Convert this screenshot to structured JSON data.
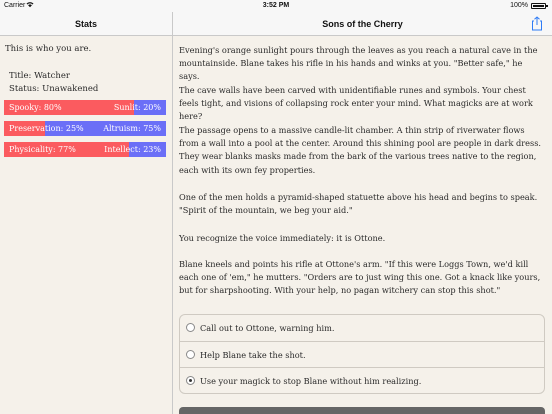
{
  "status_bar": {
    "carrier": "Carrier",
    "time": "3:52 PM",
    "battery": "100%"
  },
  "sidebar": {
    "nav_title": "Stats",
    "intro": "This is who you are.",
    "title_line": "Title: Watcher",
    "status_line": "Status: Unawakened",
    "bars": [
      {
        "left": "Spooky: 80%",
        "right": "Sunlit: 20%",
        "fill": 0.8
      },
      {
        "left": "Preservation: 25%",
        "right": "Altruism: 75%",
        "fill": 0.25
      },
      {
        "left": "Physicality: 77%",
        "right": "Intellect: 23%",
        "fill": 0.77
      }
    ],
    "colors": {
      "left_fill": "#fb5b5f",
      "right_fill": "#6b6ff7"
    }
  },
  "main": {
    "nav_title": "Sons of the Cherry",
    "paragraphs": [
      "Evening's orange sunlight pours through the leaves as you reach a natural cave in the mountainside. Blane takes his rifle in his hands and winks at you. \"Better safe,\" he says.",
      "The cave walls have been carved with unidentifiable runes and symbols. Your chest feels tight, and visions of collapsing rock enter your mind. What magicks are at work here?",
      "The passage opens to a massive candle-lit chamber. A thin strip of riverwater flows from a wall into a pool at the center. Around this shining pool are people in dark dress. They wear blanks masks made from the bark of the various trees native to the region, each with its own fey properties.",
      "One of the men holds a pyramid-shaped statuette above his head and begins to speak. \"Spirit of the mountain, we beg your aid.\"",
      "You recognize the voice immediately: it is Ottone.",
      "Blane kneels and points his rifle at Ottone's arm. \"If this were Loggs Town, we'd kill each one of 'em,\" he mutters. \"Orders are to just wing this one. Got a knack like yours, but for sharpshooting. With your help, no pagan witchery can stop this shot.\""
    ],
    "choices": [
      {
        "label": "Call out to Ottone, warning him.",
        "selected": false
      },
      {
        "label": "Help Blane take the shot.",
        "selected": false
      },
      {
        "label": "Use your magick to stop Blane without him realizing.",
        "selected": true
      }
    ]
  }
}
